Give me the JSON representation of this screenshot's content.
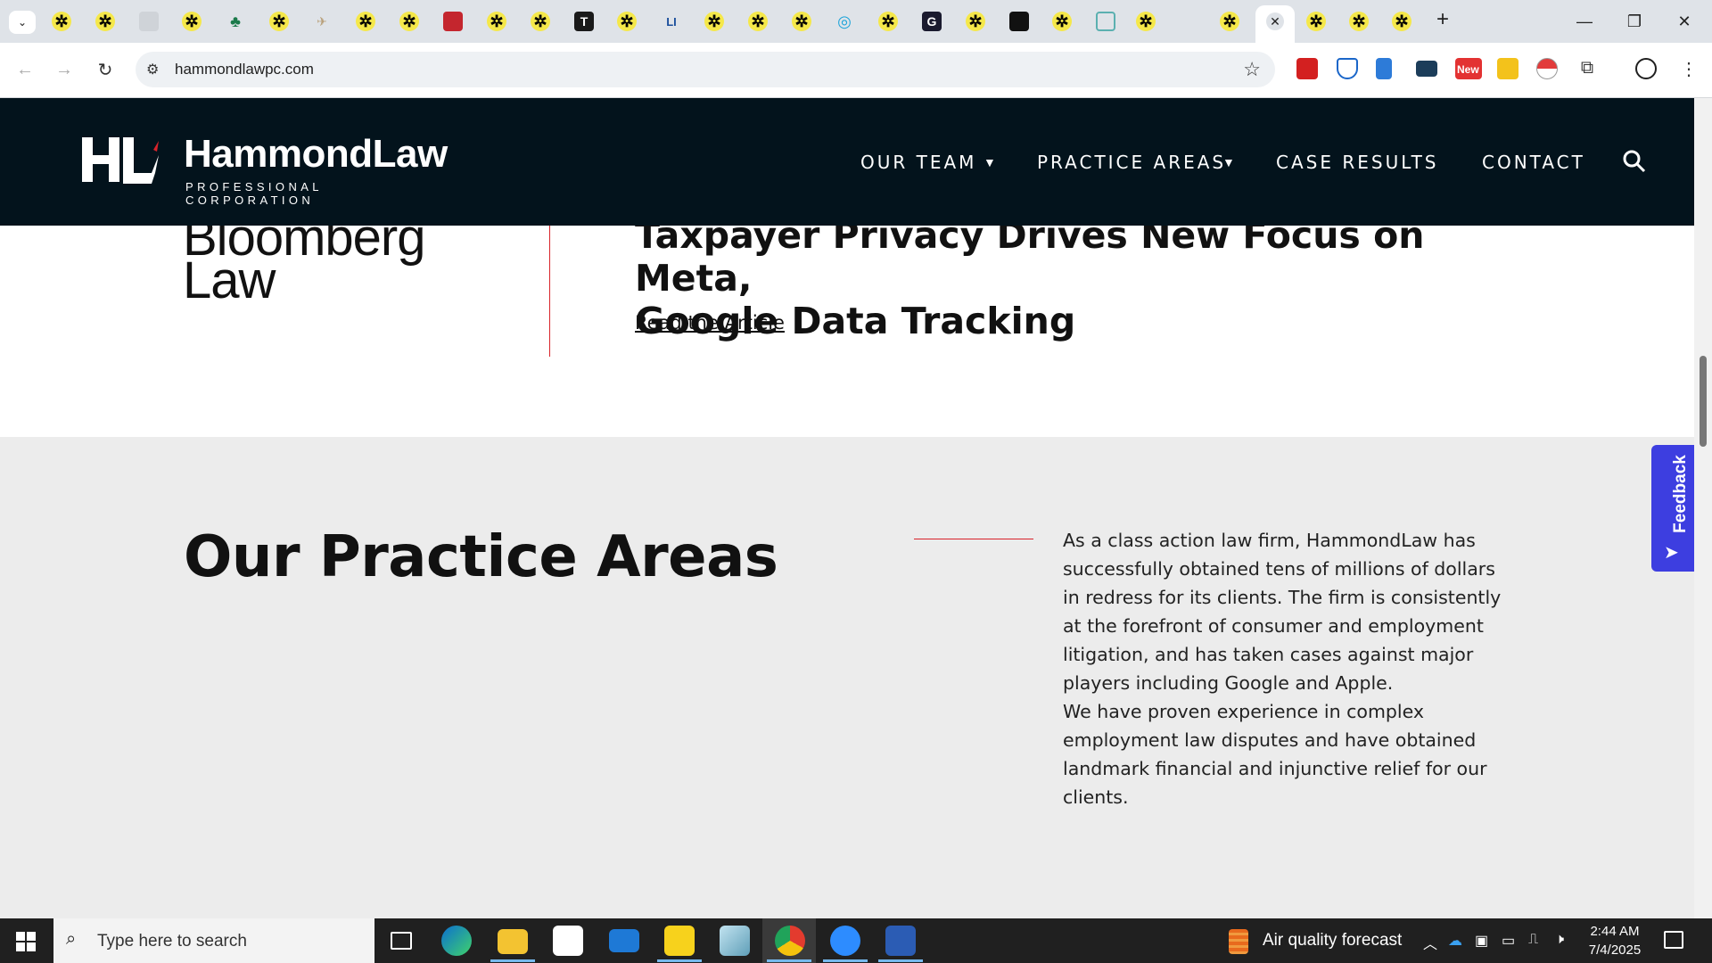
{
  "browser": {
    "url": "hammondlawpc.com",
    "tab_icons": [
      "star-favicon",
      "star-favicon",
      "page-favicon",
      "star-favicon",
      "tree-favicon",
      "star-favicon",
      "bird-favicon",
      "star-favicon",
      "star-favicon",
      "red-book-favicon",
      "star-favicon",
      "star-favicon",
      "t-favicon",
      "star-favicon",
      "li-favicon",
      "star-favicon",
      "star-favicon",
      "star-favicon",
      "globe-favicon",
      "star-favicon",
      "g-favicon",
      "star-favicon",
      "dark-favicon",
      "star-favicon",
      "doc-favicon",
      "star-favicon",
      "blank-favicon",
      "star-favicon",
      "active-close",
      "star-favicon",
      "star-favicon",
      "star-favicon"
    ],
    "new_tab_label": "+",
    "extensions_badge": "New"
  },
  "site": {
    "logo_mark": "HL",
    "logo_name": "HammondLaw",
    "logo_sub": "PROFESSIONAL CORPORATION",
    "nav": {
      "our_team": "OUR TEAM",
      "practice_areas": "PRACTICE AREAS",
      "case_results": "CASE RESULTS",
      "contact": "CONTACT",
      "caret": "▼"
    }
  },
  "press": {
    "publisher_line1": "Bloomberg",
    "publisher_line2": "Law",
    "headline_line1": "Taxpayer Privacy Drives New Focus on Meta,",
    "headline_line2": "Google Data Tracking",
    "link": "Read the Article"
  },
  "practice": {
    "title": "Our Practice Areas",
    "paragraph1": "As a class action law firm, HammondLaw has successfully obtained tens of millions of dollars in redress for its clients. The firm is consistently at the forefront of consumer and employment litigation, and has taken cases against major players including Google and Apple.",
    "paragraph2": "We have proven experience in complex employment law disputes and have obtained landmark financial and injunctive relief for our clients."
  },
  "feedback": {
    "label": "Feedback"
  },
  "taskbar": {
    "search_placeholder": "Type here to search",
    "weather": "Air quality forecast",
    "time": "2:44 AM",
    "date": "7/4/2025"
  }
}
